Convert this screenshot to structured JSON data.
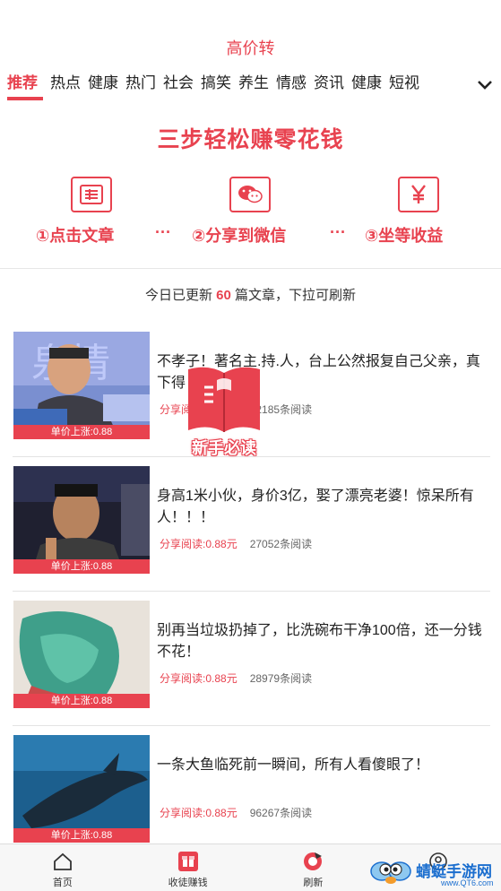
{
  "app": {
    "title": "高价转"
  },
  "tabs": [
    {
      "label": "推荐"
    },
    {
      "label": "热点"
    },
    {
      "label": "健康"
    },
    {
      "label": "热门"
    },
    {
      "label": "社会"
    },
    {
      "label": "搞笑"
    },
    {
      "label": "养生"
    },
    {
      "label": "情感"
    },
    {
      "label": "资讯"
    },
    {
      "label": "健康"
    },
    {
      "label": "短视"
    }
  ],
  "banner": {
    "title": "三步轻松赚零花钱",
    "steps": [
      {
        "label": "①点击文章",
        "icon": "article-icon"
      },
      {
        "label": "②分享到微信",
        "icon": "wechat-icon"
      },
      {
        "label": "③坐等收益",
        "icon": "yuan-icon"
      }
    ],
    "dots": "···"
  },
  "update": {
    "prefix": "今日已更新 ",
    "count": "60",
    "suffix": " 篇文章，下拉可刷新"
  },
  "articles": [
    {
      "title": "不孝子！著名主.持.人，台上公然报复自己父亲，真下得",
      "share": "分享阅读:0.88元",
      "reads": "82185条阅读",
      "price_tag": "单价上涨:0.88"
    },
    {
      "title": "身高1米小伙，身价3亿，娶了漂亮老婆！惊呆所有人！！！",
      "share": "分享阅读:0.88元",
      "reads": "27052条阅读",
      "price_tag": "单价上涨:0.88"
    },
    {
      "title": "别再当垃圾扔掉了，比洗碗布干净100倍，还一分钱不花！",
      "share": "分享阅读:0.88元",
      "reads": "28979条阅读",
      "price_tag": "单价上涨:0.88"
    },
    {
      "title": "一条大鱼临死前一瞬间，所有人看傻眼了！",
      "share": "分享阅读:0.88元",
      "reads": "96267条阅读",
      "price_tag": "单价上涨:0.88"
    }
  ],
  "newbie": {
    "label": "新手必读"
  },
  "bottom_nav": [
    {
      "label": "首页",
      "icon": "home-icon"
    },
    {
      "label": "收徒赚钱",
      "icon": "gift-icon"
    },
    {
      "label": "刷新",
      "icon": "refresh-icon"
    },
    {
      "label": "",
      "icon": "user-icon"
    }
  ],
  "watermark": {
    "text": "蜻蜓手游网",
    "url": "www.QT6.com"
  },
  "colors": {
    "accent": "#e8424f",
    "watermark": "#1c6fcf"
  }
}
